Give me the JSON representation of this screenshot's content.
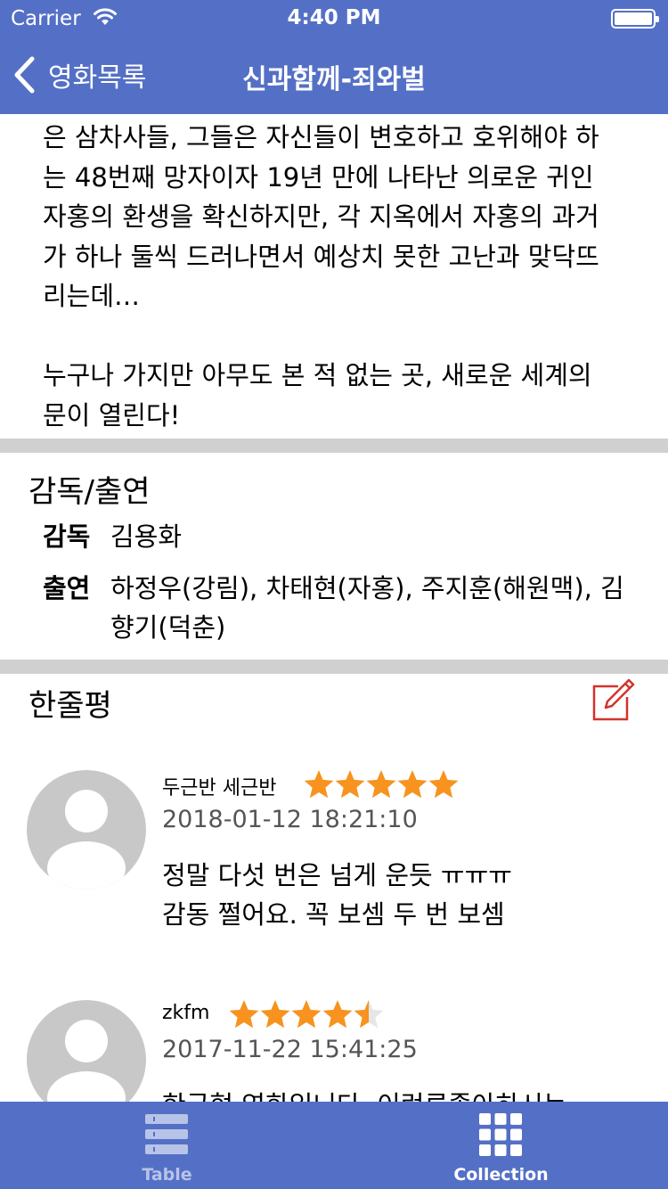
{
  "status_bar": {
    "carrier": "Carrier",
    "time": "4:40 PM"
  },
  "nav": {
    "back_label": "영화목록",
    "title": "신과함께-죄와벌"
  },
  "synopsis": {
    "lines": [
      "은 삼차사들, 그들은 자신들이 변호하고 호위해야 하",
      "는 48번째 망자이자 19년 만에 나타난 의로운 귀인",
      "자홍의 환생을 확신하지만, 각 지옥에서 자홍의 과거",
      "가 하나 둘씩 드러나면서 예상치 못한 고난과 맞닥뜨",
      "리는데…"
    ],
    "lines2": [
      "누구나 가지만 아무도 본 적 없는 곳, 새로운 세계의",
      "문이 열린다!"
    ]
  },
  "cast": {
    "section_title": "감독/출연",
    "director_key": "감독",
    "director_value": "김용화",
    "actors_key": "출연",
    "actors_value": "하정우(강림), 차태현(자홍), 주지훈(해원맥), 김향기(덕춘)"
  },
  "reviews": {
    "section_title": "한줄평",
    "items": [
      {
        "user": "두근반 세근반",
        "rating": 5,
        "date": "2018-01-12 18:21:10",
        "text_line1": "정말 다섯 번은 넘게 운듯 ㅠㅠㅠ",
        "text_line2": "감동 쩔어요. 꼭 보셈 두 번 보셈"
      },
      {
        "user": "zkfm",
        "rating": 4.5,
        "date": "2017-11-22 15:41:25",
        "text_line1": "한국형 영화입니다. 이런류좋아하시는"
      }
    ]
  },
  "tabs": [
    {
      "label": "Table",
      "icon": "list-icon",
      "active": false
    },
    {
      "label": "Collection",
      "icon": "grid-icon",
      "active": true
    }
  ],
  "colors": {
    "bar": "#5470c6",
    "star": "#f7931e",
    "edit": "#d0342c",
    "separator": "#d0d0d0"
  }
}
